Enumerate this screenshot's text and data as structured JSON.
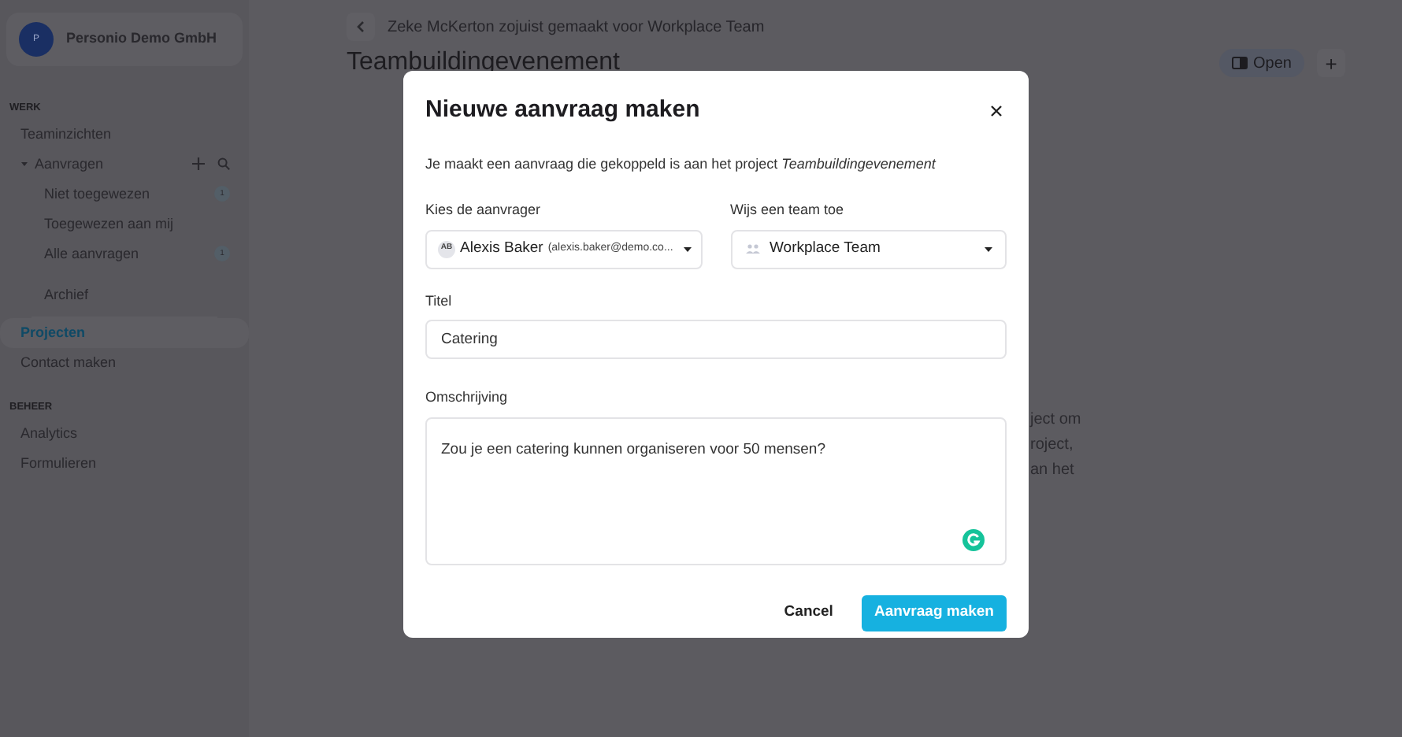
{
  "sidebar": {
    "org": {
      "initial": "P",
      "name": "Personio Demo GmbH"
    },
    "sections": [
      {
        "heading": "WERK",
        "items": [
          {
            "label": "Teaminzichten",
            "selected": false
          },
          {
            "label": "Aanvragen",
            "selected": false,
            "expanded": true,
            "children": [
              {
                "label": "Niet toegewezen",
                "badge": "1",
                "selected": false
              },
              {
                "label": "Toegewezen aan mij",
                "selected": false
              },
              {
                "label": "Alle aanvragen",
                "badge": "1",
                "selected": false
              },
              {
                "label": "Archief",
                "selected": false,
                "separated": true
              }
            ]
          },
          {
            "label": "Projecten",
            "selected": true
          },
          {
            "label": "Contact maken",
            "selected": false
          }
        ]
      },
      {
        "heading": "BEHEER",
        "items": [
          {
            "label": "Analytics",
            "selected": false
          },
          {
            "label": "Formulieren",
            "selected": false
          }
        ]
      }
    ]
  },
  "header": {
    "breadcrumb": "Zeke McKerton zojuist gemaakt voor Workplace Team",
    "title": "Teambuildingevenement",
    "status_button": "Open",
    "add_button": "+"
  },
  "background_text": [
    "ject om",
    "roject,",
    "an het"
  ],
  "dialog": {
    "title": "Nieuwe aanvraag maken",
    "intro": "Je maakt een aanvraag die gekoppeld is aan het project *Teambuildingevenement*",
    "requester": {
      "label": "Kies de aanvrager",
      "initials": "AB",
      "name": "Alexis Baker",
      "email": "(alexis.baker@demo.co..."
    },
    "team": {
      "label": "Wijs een team toe",
      "value": "Workplace Team"
    },
    "title_field": {
      "label": "Titel",
      "value": "Catering"
    },
    "description": {
      "label": "Omschrijving",
      "value": "Zou je een catering kunnen organiseren voor 50 mensen?"
    },
    "buttons": {
      "cancel": "Cancel",
      "submit": "Aanvraag maken"
    }
  }
}
